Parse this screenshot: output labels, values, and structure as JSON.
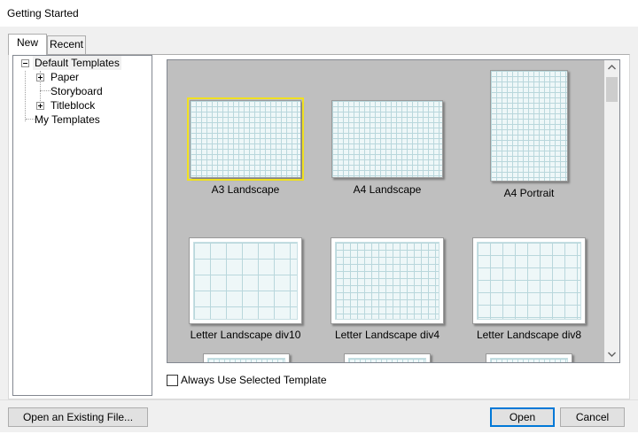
{
  "window": {
    "title": "Getting Started"
  },
  "tabs": [
    {
      "label": "New",
      "selected": true
    },
    {
      "label": "Recent",
      "selected": false
    }
  ],
  "tree": {
    "root": {
      "label": "Default Templates",
      "expanded": true
    },
    "children": [
      {
        "label": "Paper",
        "expandable": true
      },
      {
        "label": "Storyboard",
        "expandable": false
      },
      {
        "label": "Titleblock",
        "expandable": true
      }
    ],
    "my_templates": {
      "label": "My Templates"
    }
  },
  "templates": [
    {
      "label": "A3 Landscape",
      "selected": true
    },
    {
      "label": "A4 Landscape",
      "selected": false
    },
    {
      "label": "A4 Portrait",
      "selected": false
    },
    {
      "label": "Letter Landscape div10",
      "selected": false
    },
    {
      "label": "Letter Landscape div4",
      "selected": false
    },
    {
      "label": "Letter Landscape div8",
      "selected": false
    }
  ],
  "scrollbar": {
    "up_icon": "chevron-up-icon",
    "down_icon": "chevron-down-icon"
  },
  "checkbox": {
    "label": "Always Use Selected Template",
    "checked": false
  },
  "buttons": {
    "open_existing": "Open an Existing File...",
    "open": "Open",
    "cancel": "Cancel"
  },
  "colors": {
    "selection_outline": "#f0e020",
    "gallery_background": "#bfbfbf",
    "focus_border": "#0078d7"
  }
}
